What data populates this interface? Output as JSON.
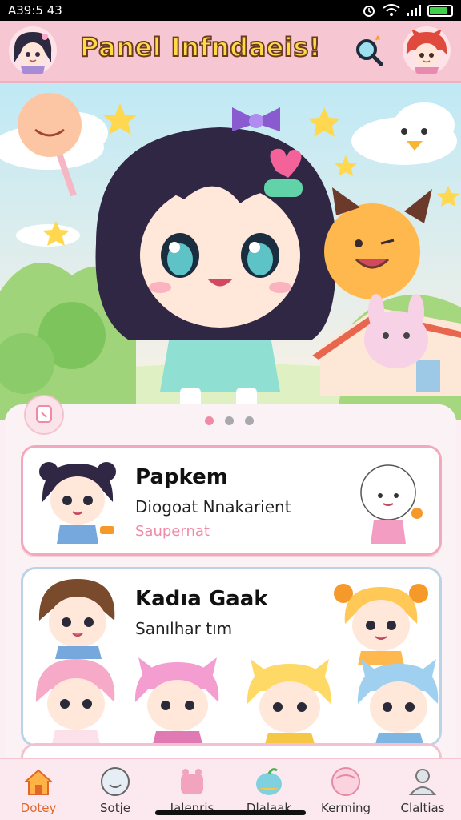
{
  "status_bar": {
    "time": "A39:5 43",
    "battery_level": 0.85
  },
  "header": {
    "title": "Panel Infndaeis!",
    "left_avatar_icon": "girl-avatar-icon",
    "right_avatar_icon": "red-hair-avatar-icon",
    "search_icon": "search-icon"
  },
  "carousel": {
    "page_count": 3,
    "active_page": 1
  },
  "cards": [
    {
      "title": "Papkem",
      "subtitle": "Diogoat Nnakarient",
      "tag": "Saupernat"
    },
    {
      "title": "Kadıa Gaak",
      "subtitle": "Sanılhar tım"
    }
  ],
  "tabs": [
    {
      "label": "Dotey",
      "icon": "home-icon",
      "active": true
    },
    {
      "label": "Sotje",
      "icon": "face-icon",
      "active": false
    },
    {
      "label": "Jalenris",
      "icon": "bag-icon",
      "active": false
    },
    {
      "label": "Dlalaak",
      "icon": "apple-icon",
      "active": false
    },
    {
      "label": "Kerming",
      "icon": "ball-icon",
      "active": false
    },
    {
      "label": "Claltias",
      "icon": "person-icon",
      "active": false
    }
  ],
  "colors": {
    "header_bg": "#f7c6d3",
    "accent_pink": "#f08aa6",
    "title_yellow": "#ffd94a",
    "active_tab": "#e2662b"
  }
}
